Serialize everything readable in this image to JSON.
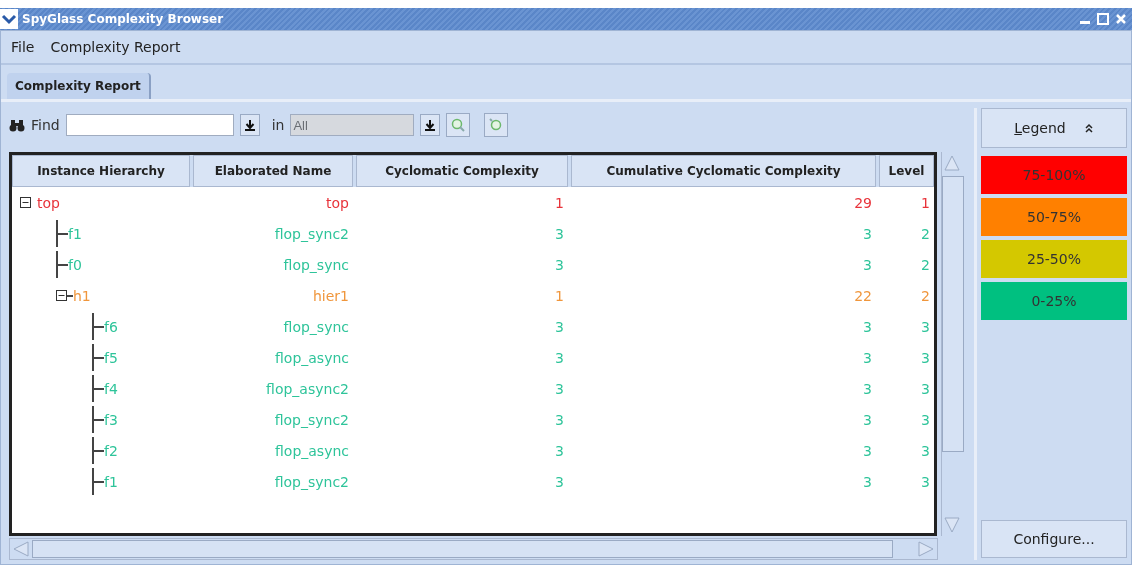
{
  "window": {
    "title": "SpyGlass Complexity Browser"
  },
  "menu": [
    "File",
    "Complexity Report"
  ],
  "tabs": [
    {
      "label": "Complexity Report",
      "selected": true
    }
  ],
  "toolbar": {
    "find_label": "Find",
    "in_label": "in",
    "scope_value": "All"
  },
  "table": {
    "columns": [
      "Instance Hierarchy",
      "Elaborated Name",
      "Cyclomatic Complexity",
      "Cumulative Cyclomatic Complexity",
      "Level"
    ],
    "rows": [
      {
        "instance": "top",
        "elaborated": "top",
        "cyclomatic": "1",
        "cumulative": "29",
        "level": "1",
        "color": "#e8333a",
        "expanded": true,
        "children": [
          {
            "instance": "f1",
            "elaborated": "flop_sync2",
            "cyclomatic": "3",
            "cumulative": "3",
            "level": "2",
            "color": "#2ec49a"
          },
          {
            "instance": "f0",
            "elaborated": "flop_sync",
            "cyclomatic": "3",
            "cumulative": "3",
            "level": "2",
            "color": "#2ec49a"
          },
          {
            "instance": "h1",
            "elaborated": "hier1",
            "cyclomatic": "1",
            "cumulative": "22",
            "level": "2",
            "color": "#f0963c",
            "expanded": true,
            "children": [
              {
                "instance": "f6",
                "elaborated": "flop_sync",
                "cyclomatic": "3",
                "cumulative": "3",
                "level": "3",
                "color": "#2ec49a"
              },
              {
                "instance": "f5",
                "elaborated": "flop_async",
                "cyclomatic": "3",
                "cumulative": "3",
                "level": "3",
                "color": "#2ec49a"
              },
              {
                "instance": "f4",
                "elaborated": "flop_async2",
                "cyclomatic": "3",
                "cumulative": "3",
                "level": "3",
                "color": "#2ec49a"
              },
              {
                "instance": "f3",
                "elaborated": "flop_sync2",
                "cyclomatic": "3",
                "cumulative": "3",
                "level": "3",
                "color": "#2ec49a"
              },
              {
                "instance": "f2",
                "elaborated": "flop_async",
                "cyclomatic": "3",
                "cumulative": "3",
                "level": "3",
                "color": "#2ec49a"
              },
              {
                "instance": "f1",
                "elaborated": "flop_sync2",
                "cyclomatic": "3",
                "cumulative": "3",
                "level": "3",
                "color": "#2ec49a"
              }
            ]
          }
        ]
      }
    ]
  },
  "legend": {
    "title": "Legend",
    "items": [
      {
        "label": "75-100%",
        "color": "#ff0000"
      },
      {
        "label": "50-75%",
        "color": "#ff8000"
      },
      {
        "label": "25-50%",
        "color": "#d4c800"
      },
      {
        "label": "0-25%",
        "color": "#00c080"
      }
    ],
    "configure": "Configure..."
  }
}
